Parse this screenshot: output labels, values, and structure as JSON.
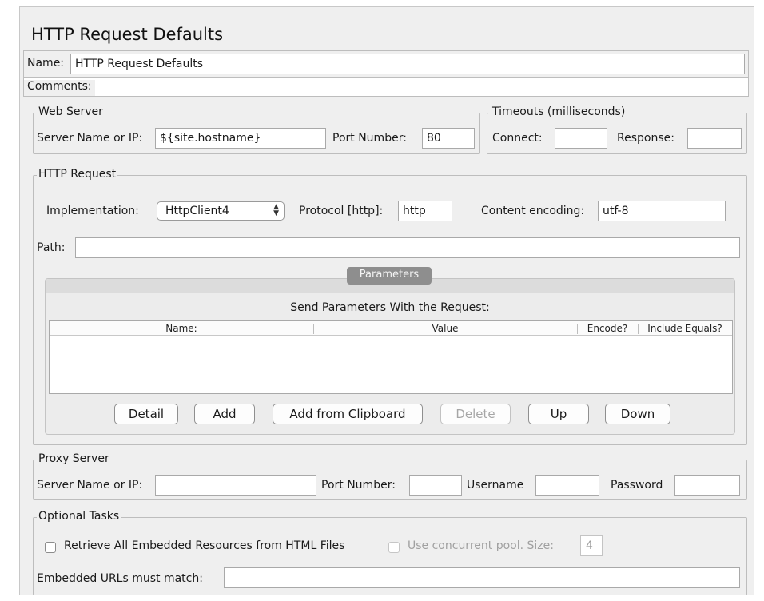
{
  "page_title": "HTTP Request Defaults",
  "name": {
    "label": "Name:",
    "value": "HTTP Request Defaults"
  },
  "comments": {
    "label": "Comments:",
    "value": ""
  },
  "web_server": {
    "legend": "Web Server",
    "server_label": "Server Name or IP:",
    "server_value": "${site.hostname}",
    "port_label": "Port Number:",
    "port_value": "80"
  },
  "timeouts": {
    "legend": "Timeouts (milliseconds)",
    "connect_label": "Connect:",
    "connect_value": "",
    "response_label": "Response:",
    "response_value": ""
  },
  "http_request": {
    "legend": "HTTP Request",
    "implementation_label": "Implementation:",
    "implementation_value": "HttpClient4",
    "protocol_label": "Protocol [http]:",
    "protocol_value": "http",
    "encoding_label": "Content encoding:",
    "encoding_value": "utf-8",
    "path_label": "Path:",
    "path_value": ""
  },
  "parameters": {
    "tab_label": "Parameters",
    "caption": "Send Parameters With the Request:",
    "columns": [
      "Name:",
      "Value",
      "Encode?",
      "Include Equals?"
    ],
    "rows": [],
    "buttons": {
      "detail": "Detail",
      "add": "Add",
      "add_clipboard": "Add from Clipboard",
      "delete": "Delete",
      "up": "Up",
      "down": "Down"
    }
  },
  "proxy": {
    "legend": "Proxy Server",
    "server_label": "Server Name or IP:",
    "server_value": "",
    "port_label": "Port Number:",
    "port_value": "",
    "username_label": "Username",
    "username_value": "",
    "password_label": "Password",
    "password_value": ""
  },
  "optional_tasks": {
    "legend": "Optional Tasks",
    "retrieve_label": "Retrieve All Embedded Resources from HTML Files",
    "retrieve_checked": false,
    "concurrent_label": "Use concurrent pool. Size:",
    "concurrent_checked": false,
    "pool_size": "4",
    "embedded_label": "Embedded URLs must match:",
    "embedded_value": ""
  }
}
